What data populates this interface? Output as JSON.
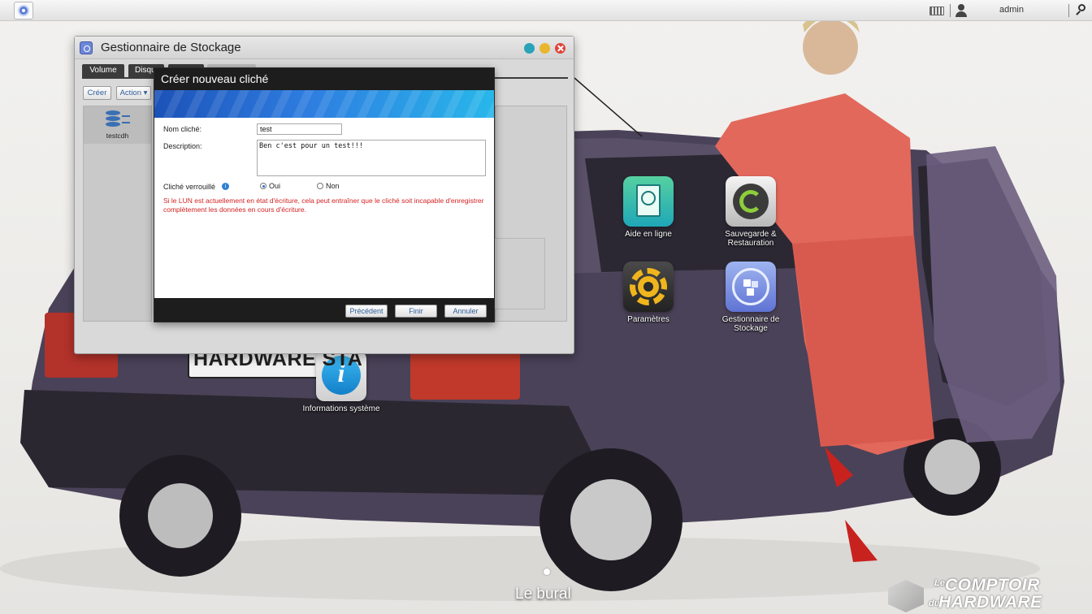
{
  "topbar": {
    "user": "admin",
    "icons": [
      "main-menu-icon",
      "keyboard-icon",
      "user-icon",
      "search-icon"
    ]
  },
  "desktop": {
    "icons": [
      {
        "label": "Aide en ligne",
        "icon": "help-manual-icon",
        "color": "#2fb58a"
      },
      {
        "label": "Sauvegarde & Restauration",
        "icon": "backup-restore-icon",
        "color": "#9a9a9a"
      },
      {
        "label": "Paramètres",
        "icon": "settings-gear-icon",
        "color": "#3a3a3a"
      },
      {
        "label": "Gestionnaire de Stockage",
        "icon": "storage-manager-icon",
        "color": "#6e85dc"
      },
      {
        "label": "Informations système",
        "icon": "info-icon",
        "color": "#1e9ae0"
      }
    ],
    "plate_text": "HARDWARE STA",
    "caption": "Le bural",
    "watermark": {
      "le": "Le",
      "comptoir": "COMPTOIR",
      "du": "du",
      "hardware": "HARDWARE"
    }
  },
  "window": {
    "title": "Gestionnaire de Stockage",
    "tabs": [
      "Volume",
      "Disque",
      "",
      ""
    ],
    "toolbar": {
      "create": "Créer",
      "action": "Action ▾"
    },
    "left_list": [
      {
        "label": "testcdh",
        "icon": "database-icon"
      }
    ]
  },
  "dialog": {
    "title": "Créer nouveau cliché",
    "name_label": "Nom cliché:",
    "name_value": "test",
    "desc_label": "Description:",
    "desc_value": "Ben c'est pour un test!!!",
    "locked_label": "Cliché verrouillé",
    "opt_yes": "Oui",
    "opt_no": "Non",
    "selected": "Oui",
    "warning": "Si le LUN est actuellement en état d'écriture, cela peut entraîner que le cliché soit incapable d'enregistrer complètement les données en cours d'écriture.",
    "buttons": {
      "prev": "Précédent",
      "finish": "Finir",
      "cancel": "Annuler"
    },
    "accent": "#2f7fe0",
    "warning_color": "#d32222"
  }
}
